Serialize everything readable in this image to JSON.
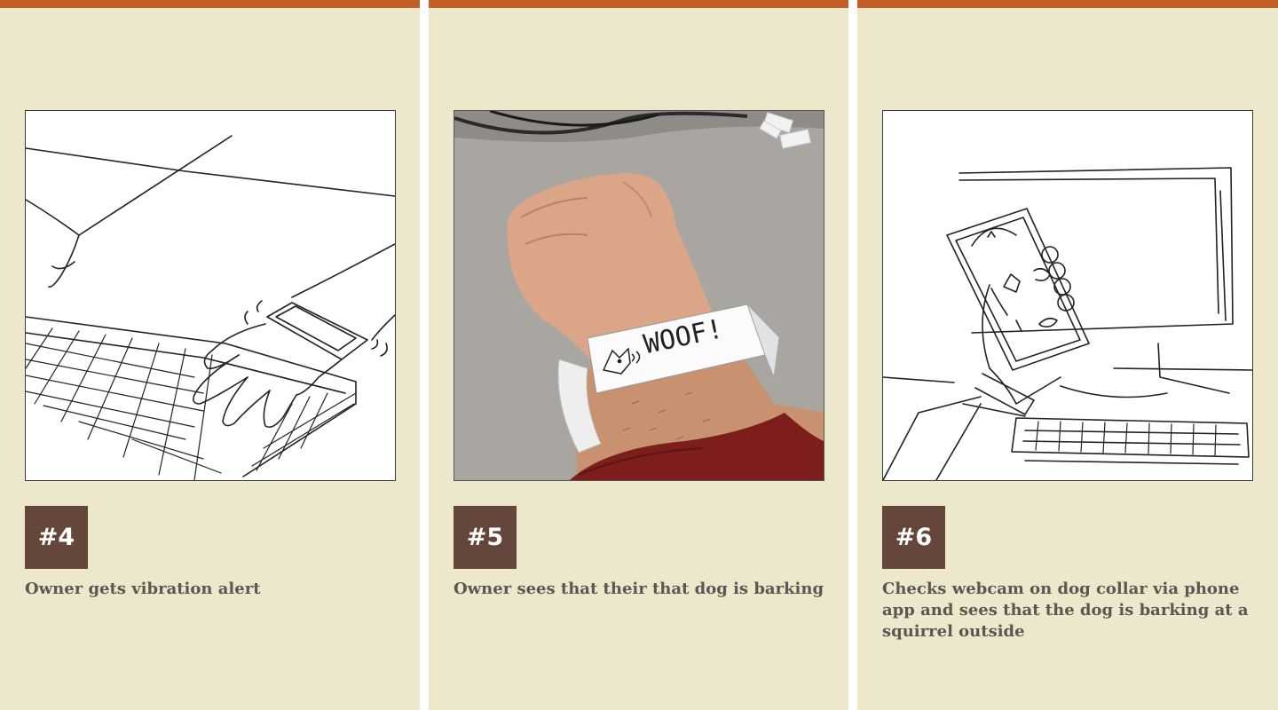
{
  "panels": [
    {
      "number": "#4",
      "caption": "Owner gets vibration alert",
      "illustration": "sketch-typing-vibration"
    },
    {
      "number": "#5",
      "caption": "Owner sees that their that dog is barking",
      "illustration": "photo-paper-wristband",
      "wristband_text": "WOOF!"
    },
    {
      "number": "#6",
      "caption": "Checks webcam on dog collar via phone app and sees that the dog is barking at a squirrel outside",
      "illustration": "sketch-phone-webcam"
    }
  ],
  "colors": {
    "background": "#ede7cb",
    "top_bar": "#c45f27",
    "badge": "#64473a",
    "caption_text": "#5a5754"
  }
}
